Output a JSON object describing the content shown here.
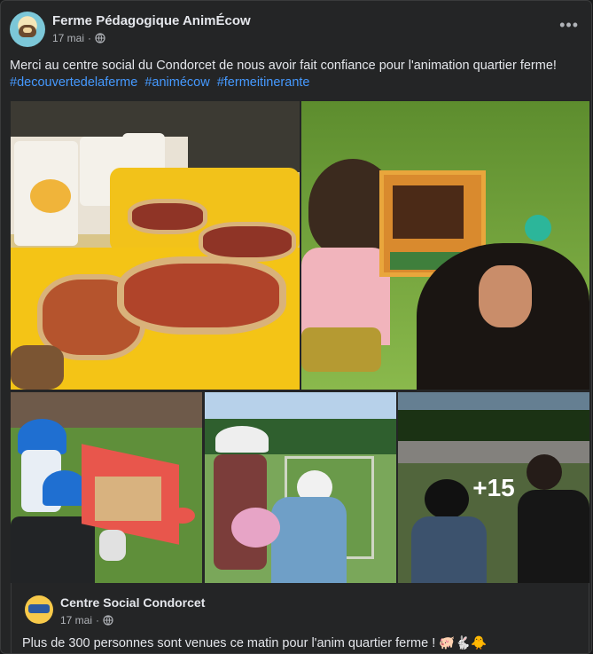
{
  "post": {
    "author": "Ferme Pédagogique AnimÉcow",
    "date": "17 mai",
    "separator": "·",
    "more_label": "•••",
    "text": "Merci au centre social du Condorcet de nous avoir fait confiance pour l'animation quartier ferme!",
    "hashtags": [
      "#decouvertedelaferme",
      "#animécow",
      "#fermeitinerante"
    ],
    "privacy_icon": "globe-icon"
  },
  "photos": {
    "more_count": "+15"
  },
  "shared_post": {
    "author": "Centre Social Condorcet",
    "date": "17 mai",
    "separator": "·",
    "text": "Plus de 300 personnes sont venues ce matin pour l'anim quartier ferme ! 🐖🐇🐥",
    "privacy_icon": "globe-icon"
  }
}
